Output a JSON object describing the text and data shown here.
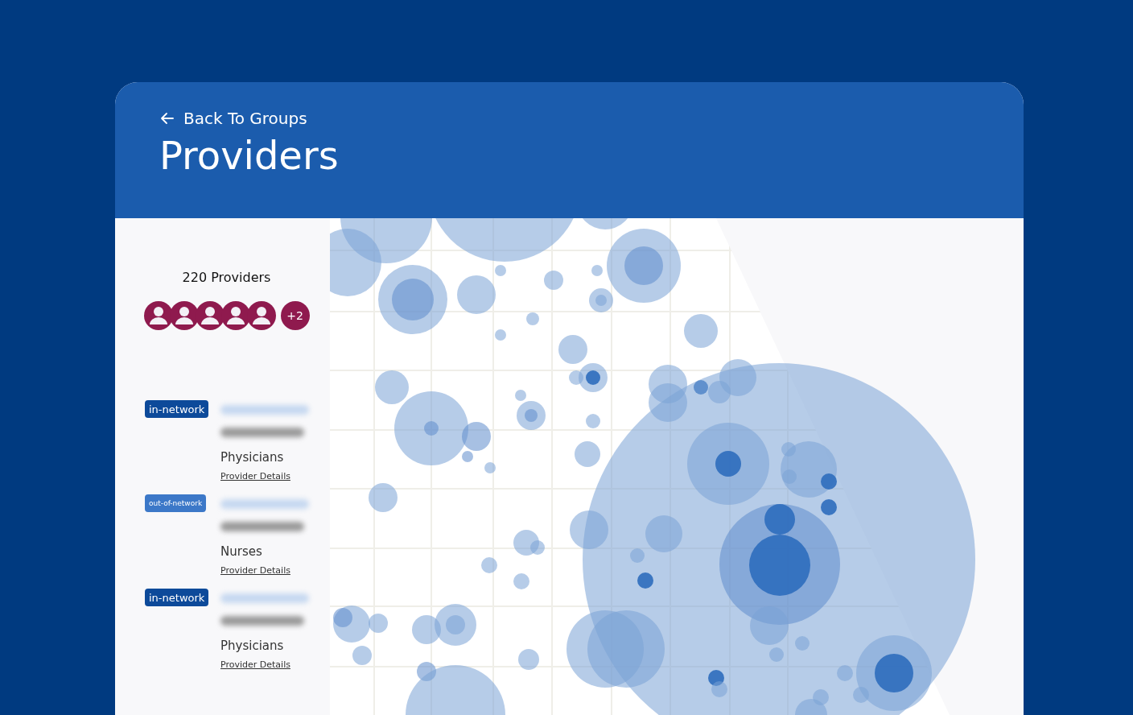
{
  "header": {
    "back_link": "Back To Groups",
    "title": "Providers"
  },
  "summary": {
    "count_label": "220 Providers",
    "avatars": [
      {
        "kind": "person"
      },
      {
        "kind": "person"
      },
      {
        "kind": "person"
      },
      {
        "kind": "person"
      },
      {
        "kind": "person"
      }
    ],
    "more_label": "+2"
  },
  "providers": [
    {
      "network": {
        "kind": "in",
        "label": "in-network"
      },
      "category": "Physicians",
      "link": "Provider Details"
    },
    {
      "network": {
        "kind": "out",
        "label": "out-of-network"
      },
      "category": "Nurses",
      "link": "Provider Details"
    },
    {
      "network": {
        "kind": "in",
        "label": "in-network"
      },
      "category": "Physicians",
      "link": "Provider Details"
    }
  ]
}
